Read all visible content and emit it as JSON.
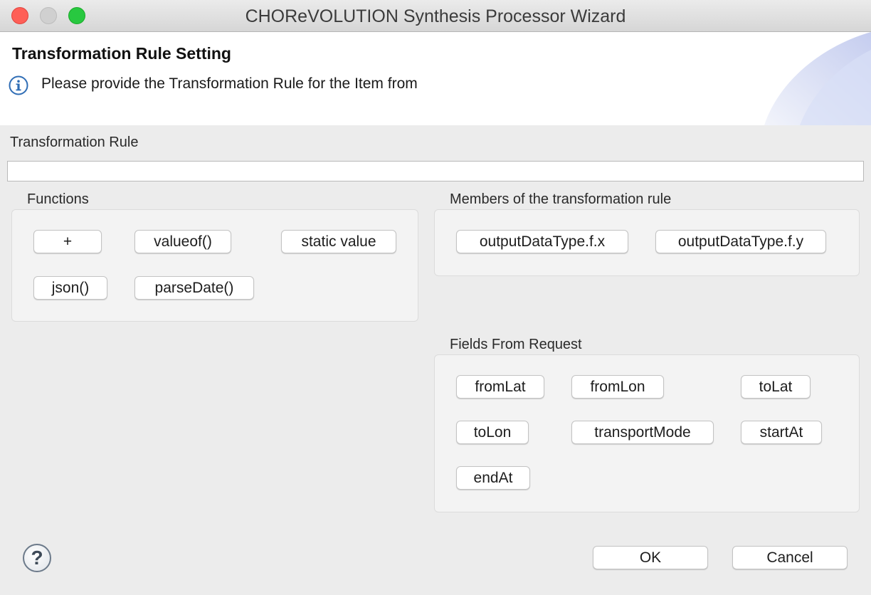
{
  "window": {
    "title": "CHOReVOLUTION Synthesis Processor Wizard"
  },
  "header": {
    "heading": "Transformation Rule Setting",
    "message": "Please provide the Transformation Rule for the Item from",
    "message_icon": "info-icon"
  },
  "rule": {
    "label": "Transformation Rule",
    "value": ""
  },
  "functions": {
    "label": "Functions",
    "buttons": [
      "+",
      "valueof()",
      "static value",
      "json()",
      "parseDate()"
    ]
  },
  "members": {
    "label": "Members of the transformation rule",
    "buttons": [
      "outputDataType.f.x",
      "outputDataType.f.y"
    ]
  },
  "fields": {
    "label": "Fields From Request",
    "buttons": [
      "fromLat",
      "fromLon",
      "toLat",
      "toLon",
      "transportMode",
      "startAt",
      "endAt"
    ]
  },
  "footer": {
    "help_icon": "question-mark-icon",
    "help_glyph": "?",
    "ok_label": "OK",
    "cancel_label": "Cancel"
  }
}
